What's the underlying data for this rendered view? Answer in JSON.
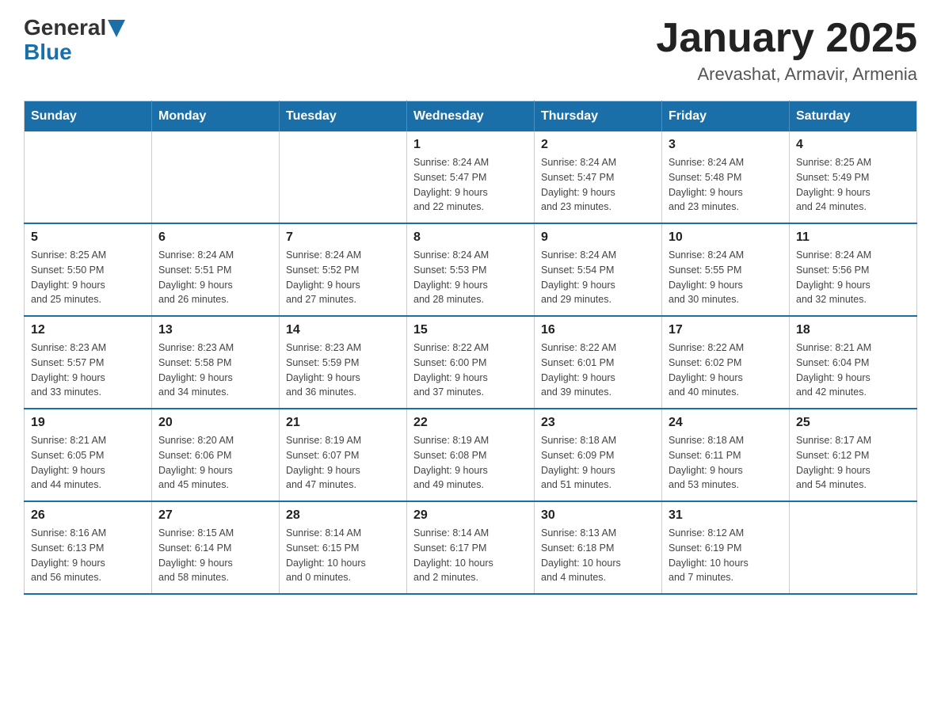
{
  "header": {
    "logo_general": "General",
    "logo_blue": "Blue",
    "title": "January 2025",
    "subtitle": "Arevashat, Armavir, Armenia"
  },
  "calendar": {
    "days_of_week": [
      "Sunday",
      "Monday",
      "Tuesday",
      "Wednesday",
      "Thursday",
      "Friday",
      "Saturday"
    ],
    "weeks": [
      [
        {
          "day": "",
          "info": ""
        },
        {
          "day": "",
          "info": ""
        },
        {
          "day": "",
          "info": ""
        },
        {
          "day": "1",
          "info": "Sunrise: 8:24 AM\nSunset: 5:47 PM\nDaylight: 9 hours\nand 22 minutes."
        },
        {
          "day": "2",
          "info": "Sunrise: 8:24 AM\nSunset: 5:47 PM\nDaylight: 9 hours\nand 23 minutes."
        },
        {
          "day": "3",
          "info": "Sunrise: 8:24 AM\nSunset: 5:48 PM\nDaylight: 9 hours\nand 23 minutes."
        },
        {
          "day": "4",
          "info": "Sunrise: 8:25 AM\nSunset: 5:49 PM\nDaylight: 9 hours\nand 24 minutes."
        }
      ],
      [
        {
          "day": "5",
          "info": "Sunrise: 8:25 AM\nSunset: 5:50 PM\nDaylight: 9 hours\nand 25 minutes."
        },
        {
          "day": "6",
          "info": "Sunrise: 8:24 AM\nSunset: 5:51 PM\nDaylight: 9 hours\nand 26 minutes."
        },
        {
          "day": "7",
          "info": "Sunrise: 8:24 AM\nSunset: 5:52 PM\nDaylight: 9 hours\nand 27 minutes."
        },
        {
          "day": "8",
          "info": "Sunrise: 8:24 AM\nSunset: 5:53 PM\nDaylight: 9 hours\nand 28 minutes."
        },
        {
          "day": "9",
          "info": "Sunrise: 8:24 AM\nSunset: 5:54 PM\nDaylight: 9 hours\nand 29 minutes."
        },
        {
          "day": "10",
          "info": "Sunrise: 8:24 AM\nSunset: 5:55 PM\nDaylight: 9 hours\nand 30 minutes."
        },
        {
          "day": "11",
          "info": "Sunrise: 8:24 AM\nSunset: 5:56 PM\nDaylight: 9 hours\nand 32 minutes."
        }
      ],
      [
        {
          "day": "12",
          "info": "Sunrise: 8:23 AM\nSunset: 5:57 PM\nDaylight: 9 hours\nand 33 minutes."
        },
        {
          "day": "13",
          "info": "Sunrise: 8:23 AM\nSunset: 5:58 PM\nDaylight: 9 hours\nand 34 minutes."
        },
        {
          "day": "14",
          "info": "Sunrise: 8:23 AM\nSunset: 5:59 PM\nDaylight: 9 hours\nand 36 minutes."
        },
        {
          "day": "15",
          "info": "Sunrise: 8:22 AM\nSunset: 6:00 PM\nDaylight: 9 hours\nand 37 minutes."
        },
        {
          "day": "16",
          "info": "Sunrise: 8:22 AM\nSunset: 6:01 PM\nDaylight: 9 hours\nand 39 minutes."
        },
        {
          "day": "17",
          "info": "Sunrise: 8:22 AM\nSunset: 6:02 PM\nDaylight: 9 hours\nand 40 minutes."
        },
        {
          "day": "18",
          "info": "Sunrise: 8:21 AM\nSunset: 6:04 PM\nDaylight: 9 hours\nand 42 minutes."
        }
      ],
      [
        {
          "day": "19",
          "info": "Sunrise: 8:21 AM\nSunset: 6:05 PM\nDaylight: 9 hours\nand 44 minutes."
        },
        {
          "day": "20",
          "info": "Sunrise: 8:20 AM\nSunset: 6:06 PM\nDaylight: 9 hours\nand 45 minutes."
        },
        {
          "day": "21",
          "info": "Sunrise: 8:19 AM\nSunset: 6:07 PM\nDaylight: 9 hours\nand 47 minutes."
        },
        {
          "day": "22",
          "info": "Sunrise: 8:19 AM\nSunset: 6:08 PM\nDaylight: 9 hours\nand 49 minutes."
        },
        {
          "day": "23",
          "info": "Sunrise: 8:18 AM\nSunset: 6:09 PM\nDaylight: 9 hours\nand 51 minutes."
        },
        {
          "day": "24",
          "info": "Sunrise: 8:18 AM\nSunset: 6:11 PM\nDaylight: 9 hours\nand 53 minutes."
        },
        {
          "day": "25",
          "info": "Sunrise: 8:17 AM\nSunset: 6:12 PM\nDaylight: 9 hours\nand 54 minutes."
        }
      ],
      [
        {
          "day": "26",
          "info": "Sunrise: 8:16 AM\nSunset: 6:13 PM\nDaylight: 9 hours\nand 56 minutes."
        },
        {
          "day": "27",
          "info": "Sunrise: 8:15 AM\nSunset: 6:14 PM\nDaylight: 9 hours\nand 58 minutes."
        },
        {
          "day": "28",
          "info": "Sunrise: 8:14 AM\nSunset: 6:15 PM\nDaylight: 10 hours\nand 0 minutes."
        },
        {
          "day": "29",
          "info": "Sunrise: 8:14 AM\nSunset: 6:17 PM\nDaylight: 10 hours\nand 2 minutes."
        },
        {
          "day": "30",
          "info": "Sunrise: 8:13 AM\nSunset: 6:18 PM\nDaylight: 10 hours\nand 4 minutes."
        },
        {
          "day": "31",
          "info": "Sunrise: 8:12 AM\nSunset: 6:19 PM\nDaylight: 10 hours\nand 7 minutes."
        },
        {
          "day": "",
          "info": ""
        }
      ]
    ]
  }
}
